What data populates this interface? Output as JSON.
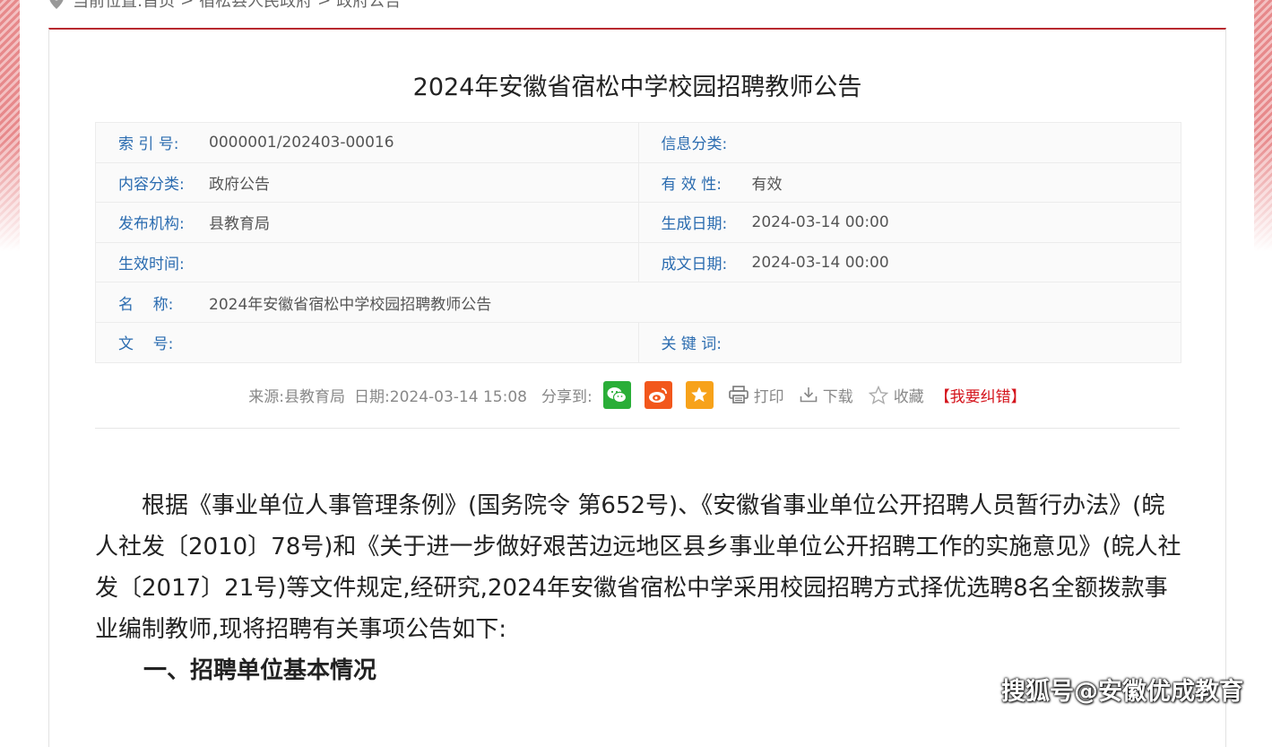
{
  "breadcrumb": {
    "prefix": "当前位置:",
    "items": [
      "首页",
      "宿松县人民政府",
      "政府公告"
    ],
    "separator": ">"
  },
  "article_title": "2024年安徽省宿松中学校园招聘教师公告",
  "meta": {
    "index_label": "索 引 号:",
    "index_value": "0000001/202403-00016",
    "info_category_label": "信息分类:",
    "info_category_value": "",
    "content_category_label": "内容分类:",
    "content_category_value": "政府公告",
    "validity_label": "有 效 性:",
    "validity_value": "有效",
    "publisher_label": "发布机构:",
    "publisher_value": "县教育局",
    "generated_date_label": "生成日期:",
    "generated_date_value": "2024-03-14 00:00",
    "effective_time_label": "生效时间:",
    "effective_time_value": "",
    "written_date_label": "成文日期:",
    "written_date_value": "2024-03-14 00:00",
    "name_label": "名    称:",
    "name_value": "2024年安徽省宿松中学校园招聘教师公告",
    "doc_no_label": "文    号:",
    "doc_no_value": "",
    "keywords_label": "关 键 词:",
    "keywords_value": ""
  },
  "toolbar": {
    "source": "来源:县教育局",
    "date": "日期:2024-03-14 15:08",
    "share_label": "分享到:",
    "print_label": "打印",
    "download_label": "下载",
    "favorite_label": "收藏",
    "report_label": "【我要纠错】"
  },
  "body": {
    "paragraph_1": "根据《事业单位人事管理条例》(国务院令 第652号)、《安徽省事业单位公开招聘人员暂行办法》(皖人社发〔2010〕78号)和《关于进一步做好艰苦边远地区县乡事业单位公开招聘工作的实施意见》(皖人社发〔2017〕21号)等文件规定,经研究,2024年安徽省宿松中学采用校园招聘方式择优选聘8名全额拨款事业编制教师,现将招聘有关事项公告如下:",
    "heading_1": "一、招聘单位基本情况"
  },
  "watermark": "搜狐号@安徽优成教育",
  "colors": {
    "accent_red": "#b8292f",
    "label_blue": "#2b6cb0",
    "wechat_green": "#2aae38",
    "weibo_orange": "#f2571c",
    "qzone_yellow": "#f7a21a",
    "report_red": "#d4141c"
  },
  "icons": [
    "location-pin-icon",
    "wechat-icon",
    "weibo-icon",
    "qzone-icon",
    "printer-icon",
    "download-icon",
    "star-icon"
  ]
}
